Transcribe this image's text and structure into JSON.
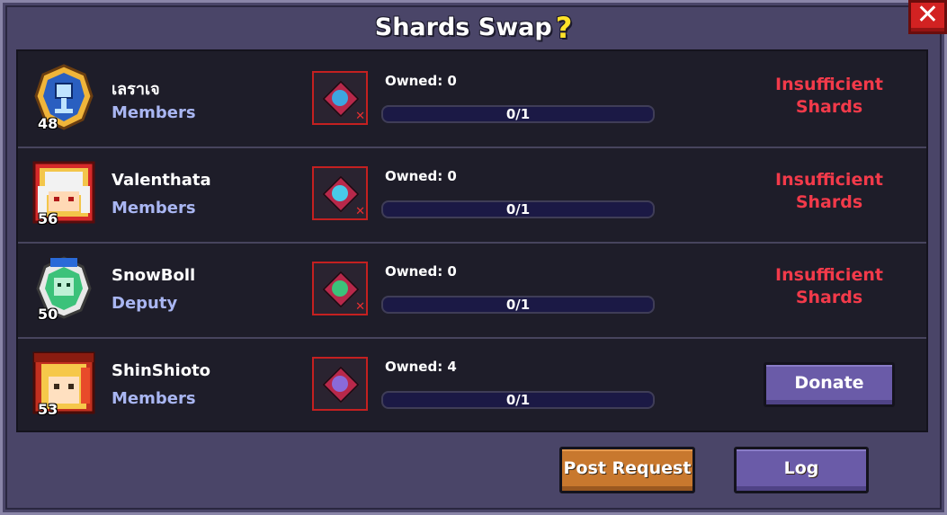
{
  "window": {
    "title": "Shards Swap",
    "help_icon": "?",
    "close_icon": "✕"
  },
  "rows": [
    {
      "name": "เลราเจ",
      "role": "Members",
      "level": "48",
      "owned": "Owned: 0",
      "progress": "0/1",
      "progress_value": 0,
      "status": "Insufficient Shards",
      "status_line1": "Insufficient",
      "status_line2": "Shards",
      "avatar_icon": "blue-chalice-emblem",
      "shard_icon": "blue-shard",
      "shard_color": "#3da6e0"
    },
    {
      "name": "Valenthata",
      "role": "Members",
      "level": "56",
      "owned": "Owned: 0",
      "progress": "0/1",
      "progress_value": 0,
      "status": "Insufficient Shards",
      "status_line1": "Insufficient",
      "status_line2": "Shards",
      "avatar_icon": "white-haired-hero-portrait",
      "shard_icon": "cyan-shard",
      "shard_color": "#48c9e8"
    },
    {
      "name": "SnowBoll",
      "role": "Deputy",
      "level": "50",
      "owned": "Owned: 0",
      "progress": "0/1",
      "progress_value": 0,
      "status": "Insufficient Shards",
      "status_line1": "Insufficient",
      "status_line2": "Shards",
      "avatar_icon": "green-crowned-emblem",
      "shard_icon": "green-shard",
      "shard_color": "#3cc27a"
    },
    {
      "name": "ShinShioto",
      "role": "Members",
      "level": "53",
      "owned": "Owned: 4",
      "progress": "0/1",
      "progress_value": 0,
      "status": "",
      "action_label": "Donate",
      "avatar_icon": "blonde-hero-portrait",
      "shard_icon": "purple-shard",
      "shard_color": "#8a6ad8"
    }
  ],
  "footer": {
    "post_request_label": "Post Request",
    "log_label": "Log"
  },
  "colors": {
    "insufficient": "#f23a4a",
    "role": "#a9b6f2",
    "button_purple": "#6a5ba8",
    "button_orange": "#c8782e"
  }
}
